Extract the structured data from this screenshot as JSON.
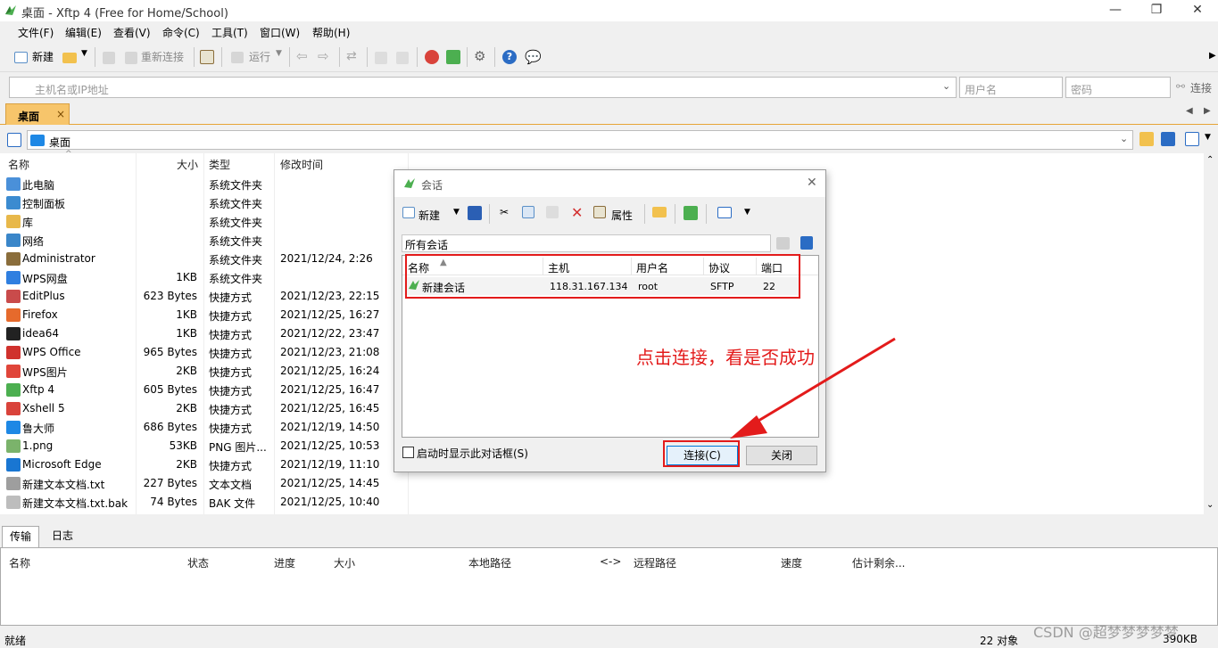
{
  "window": {
    "title": "桌面 - Xftp 4 (Free for Home/School)",
    "min": "—",
    "max": "❐",
    "close": "✕"
  },
  "menu": [
    "文件(F)",
    "编辑(E)",
    "查看(V)",
    "命令(C)",
    "工具(T)",
    "窗口(W)",
    "帮助(H)"
  ],
  "toolbar": {
    "new": "新建",
    "reconnect": "重新连接",
    "run": "运行"
  },
  "address": {
    "host_placeholder": "主机名或IP地址",
    "user_placeholder": "用户名",
    "pass_placeholder": "密码",
    "connect": "连接"
  },
  "tab": {
    "label": "桌面",
    "close": "×"
  },
  "path": {
    "value": "桌面"
  },
  "columns": {
    "name": "名称",
    "size": "大小",
    "type": "类型",
    "modified": "修改时间"
  },
  "files": [
    {
      "name": "此电脑",
      "size": "",
      "type": "系统文件夹",
      "modified": "",
      "color": "#4a90d9"
    },
    {
      "name": "控制面板",
      "size": "",
      "type": "系统文件夹",
      "modified": "",
      "color": "#3b8bd0"
    },
    {
      "name": "库",
      "size": "",
      "type": "系统文件夹",
      "modified": "",
      "color": "#e8b84a"
    },
    {
      "name": "网络",
      "size": "",
      "type": "系统文件夹",
      "modified": "",
      "color": "#3a86c9"
    },
    {
      "name": "Administrator",
      "size": "",
      "type": "系统文件夹",
      "modified": "2021/12/24, 2:26",
      "color": "#8a6d3b"
    },
    {
      "name": "WPS网盘",
      "size": "1KB",
      "type": "系统文件夹",
      "modified": "",
      "color": "#2f7fe0"
    },
    {
      "name": "EditPlus",
      "size": "623 Bytes",
      "type": "快捷方式",
      "modified": "2021/12/23, 22:15",
      "color": "#c94b4b"
    },
    {
      "name": "Firefox",
      "size": "1KB",
      "type": "快捷方式",
      "modified": "2021/12/25, 16:27",
      "color": "#e66a2c"
    },
    {
      "name": "idea64",
      "size": "1KB",
      "type": "快捷方式",
      "modified": "2021/12/22, 23:47",
      "color": "#222222"
    },
    {
      "name": "WPS Office",
      "size": "965 Bytes",
      "type": "快捷方式",
      "modified": "2021/12/23, 21:08",
      "color": "#d0312d"
    },
    {
      "name": "WPS图片",
      "size": "2KB",
      "type": "快捷方式",
      "modified": "2021/12/25, 16:24",
      "color": "#e0453a"
    },
    {
      "name": "Xftp 4",
      "size": "605 Bytes",
      "type": "快捷方式",
      "modified": "2021/12/25, 16:47",
      "color": "#4caf50"
    },
    {
      "name": "Xshell 5",
      "size": "2KB",
      "type": "快捷方式",
      "modified": "2021/12/25, 16:45",
      "color": "#d9433b"
    },
    {
      "name": "鲁大师",
      "size": "686 Bytes",
      "type": "快捷方式",
      "modified": "2021/12/19, 14:50",
      "color": "#1e88e5"
    },
    {
      "name": "1.png",
      "size": "53KB",
      "type": "PNG 图片...",
      "modified": "2021/12/25, 10:53",
      "color": "#7bb36b"
    },
    {
      "name": "Microsoft Edge",
      "size": "2KB",
      "type": "快捷方式",
      "modified": "2021/12/19, 11:10",
      "color": "#1976d2"
    },
    {
      "name": "新建文本文档.txt",
      "size": "227 Bytes",
      "type": "文本文档",
      "modified": "2021/12/25, 14:45",
      "color": "#9e9e9e"
    },
    {
      "name": "新建文本文档.txt.bak",
      "size": "74 Bytes",
      "type": "BAK 文件",
      "modified": "2021/12/25, 10:40",
      "color": "#bdbdbd"
    }
  ],
  "bottom_tabs": [
    "传输",
    "日志"
  ],
  "transfer_columns": [
    "名称",
    "状态",
    "进度",
    "大小",
    "本地路径",
    "<->",
    "远程路径",
    "速度",
    "估计剩余..."
  ],
  "status": {
    "left": "就绪",
    "count": "22 对象",
    "size": "390KB"
  },
  "dialog": {
    "title": "会话",
    "close": "✕",
    "new": "新建",
    "properties": "属性",
    "folder": "所有会话",
    "columns": {
      "name": "名称",
      "host": "主机",
      "user": "用户名",
      "protocol": "协议",
      "port": "端口"
    },
    "sessions": [
      {
        "name": "新建会话",
        "host": "118.31.167.134",
        "user": "root",
        "protocol": "SFTP",
        "port": "22"
      }
    ],
    "show_on_start": "启动时显示此对话框(S)",
    "connect": "连接(C)",
    "close_btn": "关闭"
  },
  "annotation": "点击连接，看是否成功",
  "watermark": "CSDN @超梦梦梦梦梦"
}
